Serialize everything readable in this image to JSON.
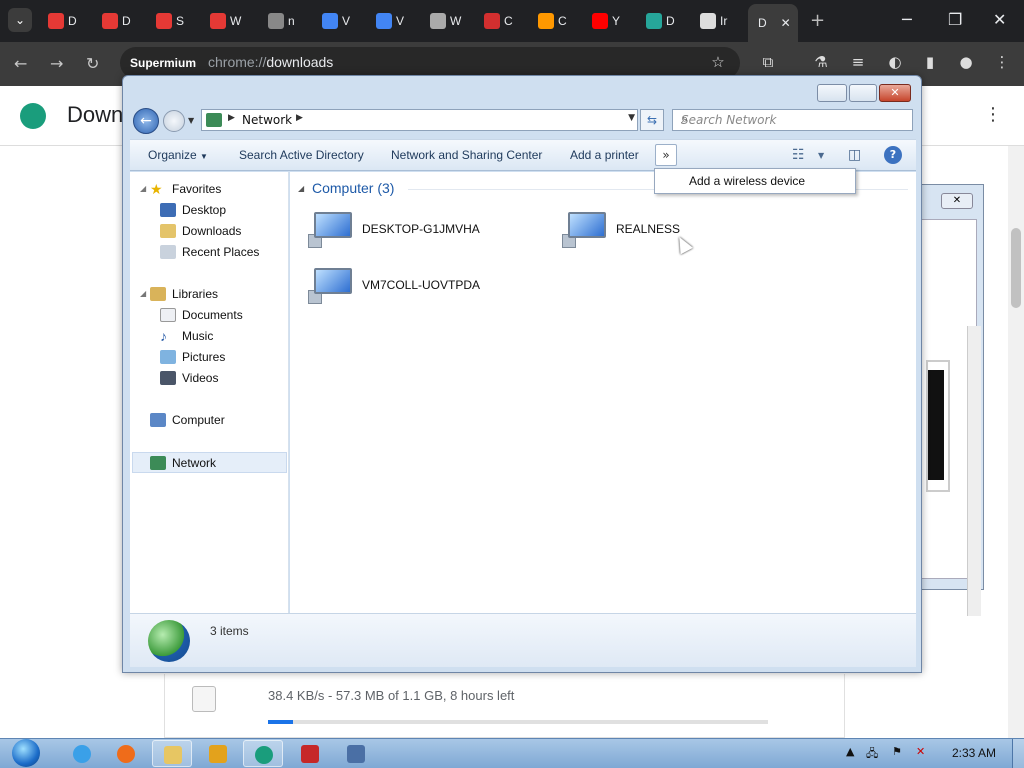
{
  "chrome": {
    "tabs": [
      {
        "letter": "D",
        "color": "#e53935"
      },
      {
        "letter": "D",
        "color": "#e53935"
      },
      {
        "letter": "S",
        "color": "#e53935"
      },
      {
        "letter": "W",
        "color": "#e53935"
      },
      {
        "letter": "n",
        "color": "#888888"
      },
      {
        "letter": "V",
        "color": "#4285f4"
      },
      {
        "letter": "V",
        "color": "#4285f4"
      },
      {
        "letter": "W",
        "color": "#aaaaaa"
      },
      {
        "letter": "C",
        "color": "#d32f2f"
      },
      {
        "letter": "C",
        "color": "#ff9800"
      },
      {
        "letter": "Y",
        "color": "#ff0000"
      },
      {
        "letter": "D",
        "color": "#26a69a"
      },
      {
        "letter": "Ir",
        "color": "#dddddd"
      }
    ],
    "active_tab": {
      "letter": "D",
      "close": "✕"
    },
    "new_tab": "+",
    "window_buttons": {
      "minimize": "─",
      "restore": "❐",
      "close": "✕"
    },
    "omnibox": {
      "chip": "Supermium",
      "scheme": "chrome://",
      "path": "downloads"
    },
    "toolbar_icons": [
      "star-icon",
      "extension-icon",
      "labs-icon",
      "media-icon",
      "profile-sync-icon",
      "sidepanel-icon",
      "account-icon",
      "menu-icon"
    ]
  },
  "downloads_page": {
    "title": "Down",
    "status_text": "38.4 KB/s - 57.3 MB of 1.1 GB, 8 hours left",
    "progress_fraction": 0.05
  },
  "explorer": {
    "address": {
      "root": "Network"
    },
    "search_placeholder": "Search Network",
    "commands": {
      "organize": "Organize",
      "search_ad": "Search Active Directory",
      "network_center": "Network and Sharing Center",
      "add_printer": "Add a printer",
      "overflow": "»"
    },
    "overflow_menu": {
      "item": "Add a wireless device"
    },
    "nav": {
      "favorites": "Favorites",
      "desktop": "Desktop",
      "downloads": "Downloads",
      "recent": "Recent Places",
      "libraries": "Libraries",
      "documents": "Documents",
      "music": "Music",
      "pictures": "Pictures",
      "videos": "Videos",
      "computer": "Computer",
      "network": "Network"
    },
    "group": {
      "header": "Computer (3)"
    },
    "computers": [
      "DESKTOP-G1JMVHA",
      "REALNESS",
      "VM7COLL-UOVTPDA"
    ],
    "details": {
      "count": "3 items"
    }
  },
  "taskbar": {
    "clock": "2:33 AM"
  }
}
